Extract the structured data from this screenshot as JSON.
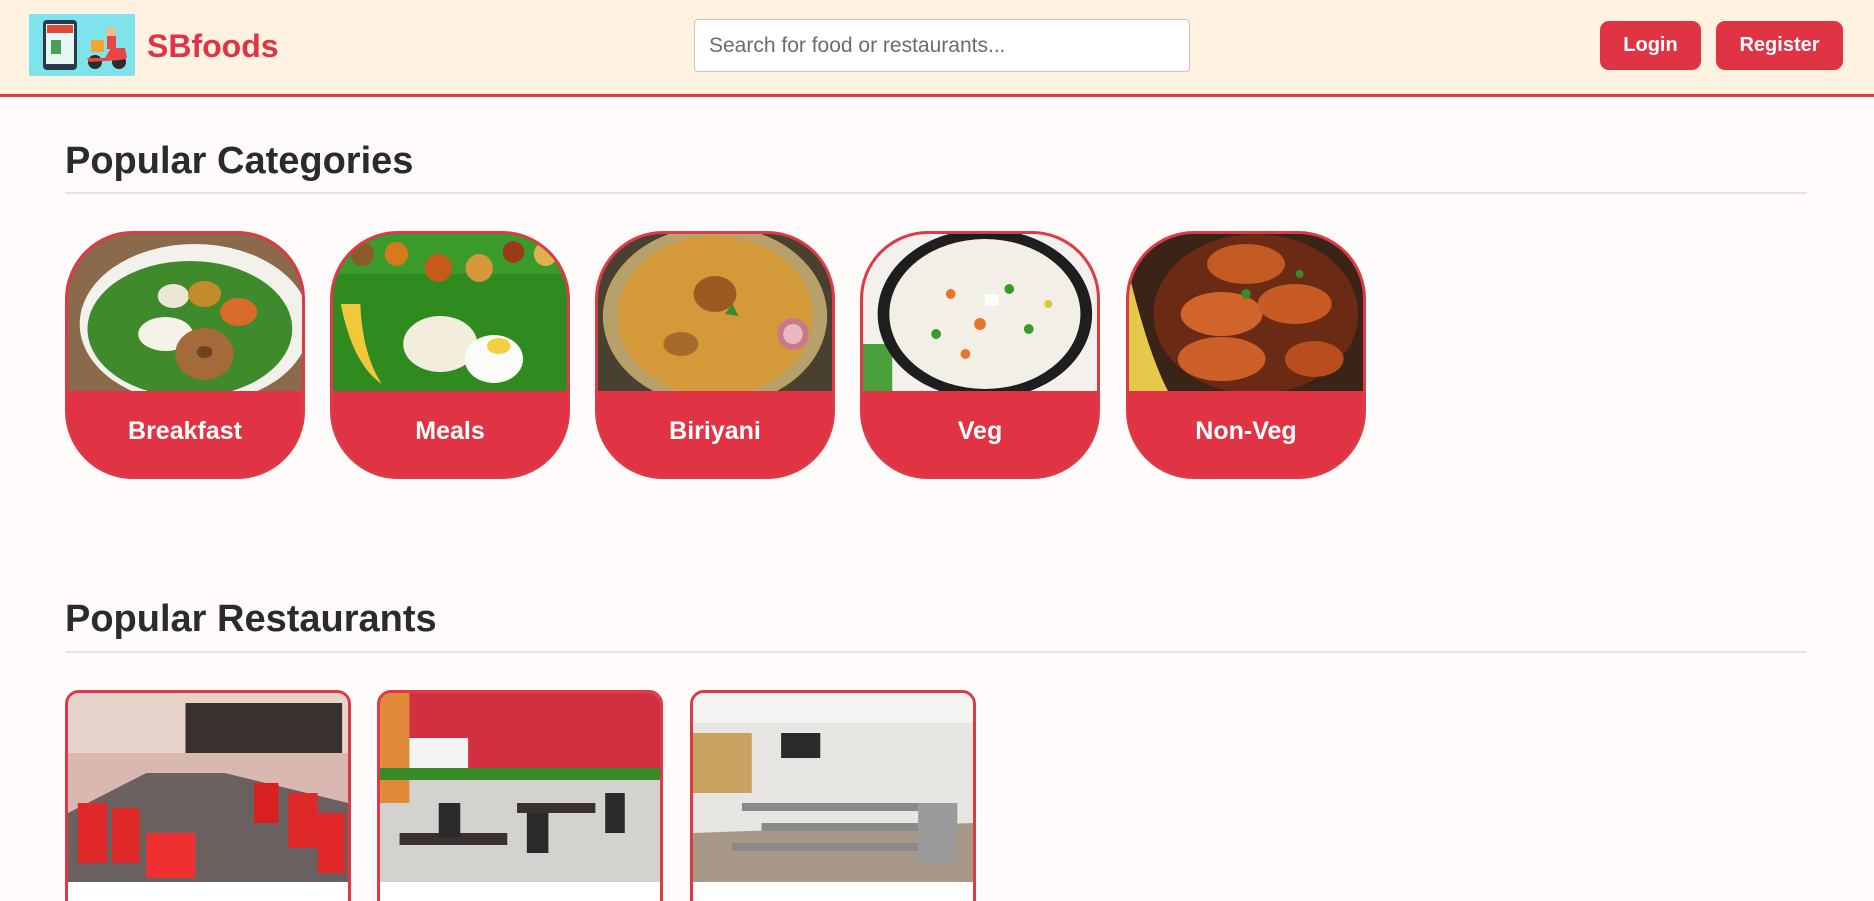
{
  "header": {
    "brand": "SBfoods",
    "logo_icon": "delivery-scooter-logo",
    "search_placeholder": "Search for food or restaurants...",
    "login_label": "Login",
    "register_label": "Register",
    "accent_color": "#e03444",
    "background_color": "#fff2e0"
  },
  "categories": {
    "title": "Popular Categories",
    "items": [
      {
        "label": "Breakfast"
      },
      {
        "label": "Meals"
      },
      {
        "label": "Biriyani"
      },
      {
        "label": "Veg"
      },
      {
        "label": "Non-Veg"
      }
    ]
  },
  "restaurants": {
    "title": "Popular Restaurants",
    "count_visible": 3
  }
}
